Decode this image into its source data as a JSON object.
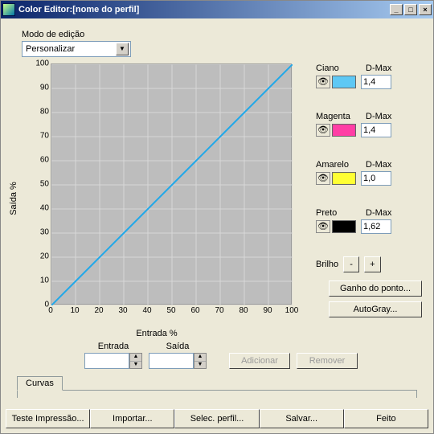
{
  "window": {
    "title": "Color Editor:[nome do perfil]"
  },
  "mode": {
    "label": "Modo de edição",
    "value": "Personalizar"
  },
  "chart_data": {
    "type": "line",
    "x": [
      0,
      10,
      20,
      30,
      40,
      50,
      60,
      70,
      80,
      90,
      100
    ],
    "series": [
      {
        "name": "curve",
        "values": [
          0,
          10,
          20,
          30,
          40,
          50,
          60,
          70,
          80,
          90,
          100
        ]
      }
    ],
    "xlabel": "Entrada %",
    "ylabel": "Saída %",
    "xlim": [
      0,
      100
    ],
    "ylim": [
      0,
      100
    ],
    "ticks": [
      0,
      10,
      20,
      30,
      40,
      50,
      60,
      70,
      80,
      90,
      100
    ],
    "grid": true
  },
  "channels": [
    {
      "name": "Ciano",
      "dmax_label": "D-Max",
      "dmax": "1,4",
      "color": "#5ec8f4"
    },
    {
      "name": "Magenta",
      "dmax_label": "D-Max",
      "dmax": "1,4",
      "color": "#ff3ea5"
    },
    {
      "name": "Amarelo",
      "dmax_label": "D-Max",
      "dmax": "1,0",
      "color": "#ffff33"
    },
    {
      "name": "Preto",
      "dmax_label": "D-Max",
      "dmax": "1,62",
      "color": "#000000"
    }
  ],
  "brightness": {
    "label": "Brilho",
    "minus": "-",
    "plus": "+"
  },
  "side_buttons": {
    "dotgain": "Ganho do ponto...",
    "autogray": "AutoGray..."
  },
  "io": {
    "entrada": "Entrada",
    "saida": "Saída",
    "adicionar": "Adicionar",
    "remover": "Remover"
  },
  "tab": "Curvas",
  "bottom": {
    "test": "Teste Impressão...",
    "import": "Importar...",
    "select": "Selec. perfil...",
    "save": "Salvar...",
    "done": "Feito"
  }
}
